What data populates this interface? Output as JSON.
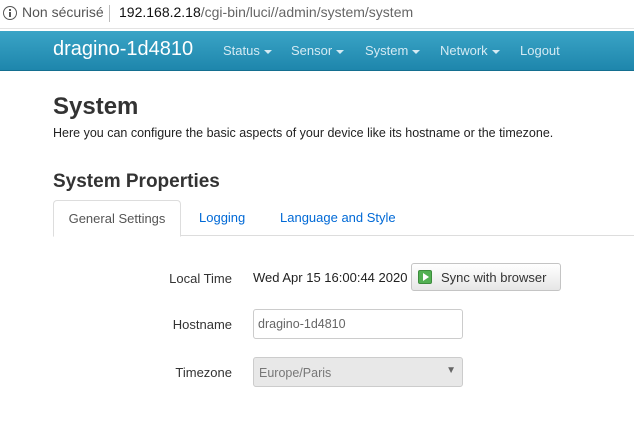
{
  "browser": {
    "security_label": "Non sécurisé",
    "url_host": "192.168.2.18",
    "url_path": "/cgi-bin/luci//admin/system/system"
  },
  "navbar": {
    "brand": "dragino-1d4810",
    "items": [
      {
        "label": "Status",
        "dropdown": true
      },
      {
        "label": "Sensor",
        "dropdown": true
      },
      {
        "label": "System",
        "dropdown": true
      },
      {
        "label": "Network",
        "dropdown": true
      },
      {
        "label": "Logout",
        "dropdown": false
      }
    ]
  },
  "page": {
    "title": "System",
    "description": "Here you can configure the basic aspects of your device like its hostname or the timezone.",
    "section_title": "System Properties"
  },
  "tabs": [
    {
      "label": "General Settings",
      "active": true
    },
    {
      "label": "Logging",
      "active": false
    },
    {
      "label": "Language and Style",
      "active": false
    }
  ],
  "form": {
    "local_time": {
      "label": "Local Time",
      "value": "Wed Apr 15 16:00:44 2020",
      "button": "Sync with browser"
    },
    "hostname": {
      "label": "Hostname",
      "value": "dragino-1d4810"
    },
    "timezone": {
      "label": "Timezone",
      "value": "Europe/Paris"
    }
  },
  "colors": {
    "navbar": "#2a96bd",
    "link": "#0069d6",
    "sync_icon": "#52b052"
  }
}
